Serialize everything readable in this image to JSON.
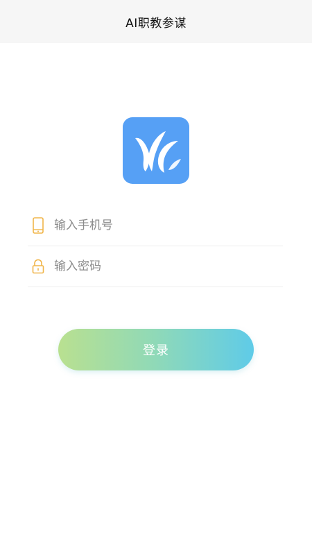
{
  "navbar": {
    "title": "AI职教参谋"
  },
  "logo": {
    "icon": "app-logo-icon",
    "background": "#56a0f5"
  },
  "form": {
    "phone": {
      "icon": "phone-icon",
      "placeholder": "输入手机号",
      "value": ""
    },
    "password": {
      "icon": "lock-icon",
      "placeholder": "输入密码",
      "value": ""
    }
  },
  "login_button": {
    "label": "登录"
  },
  "colors": {
    "icon_accent": "#f0b54a",
    "button_gradient_start": "#b9e090",
    "button_gradient_end": "#5fcbe8"
  }
}
